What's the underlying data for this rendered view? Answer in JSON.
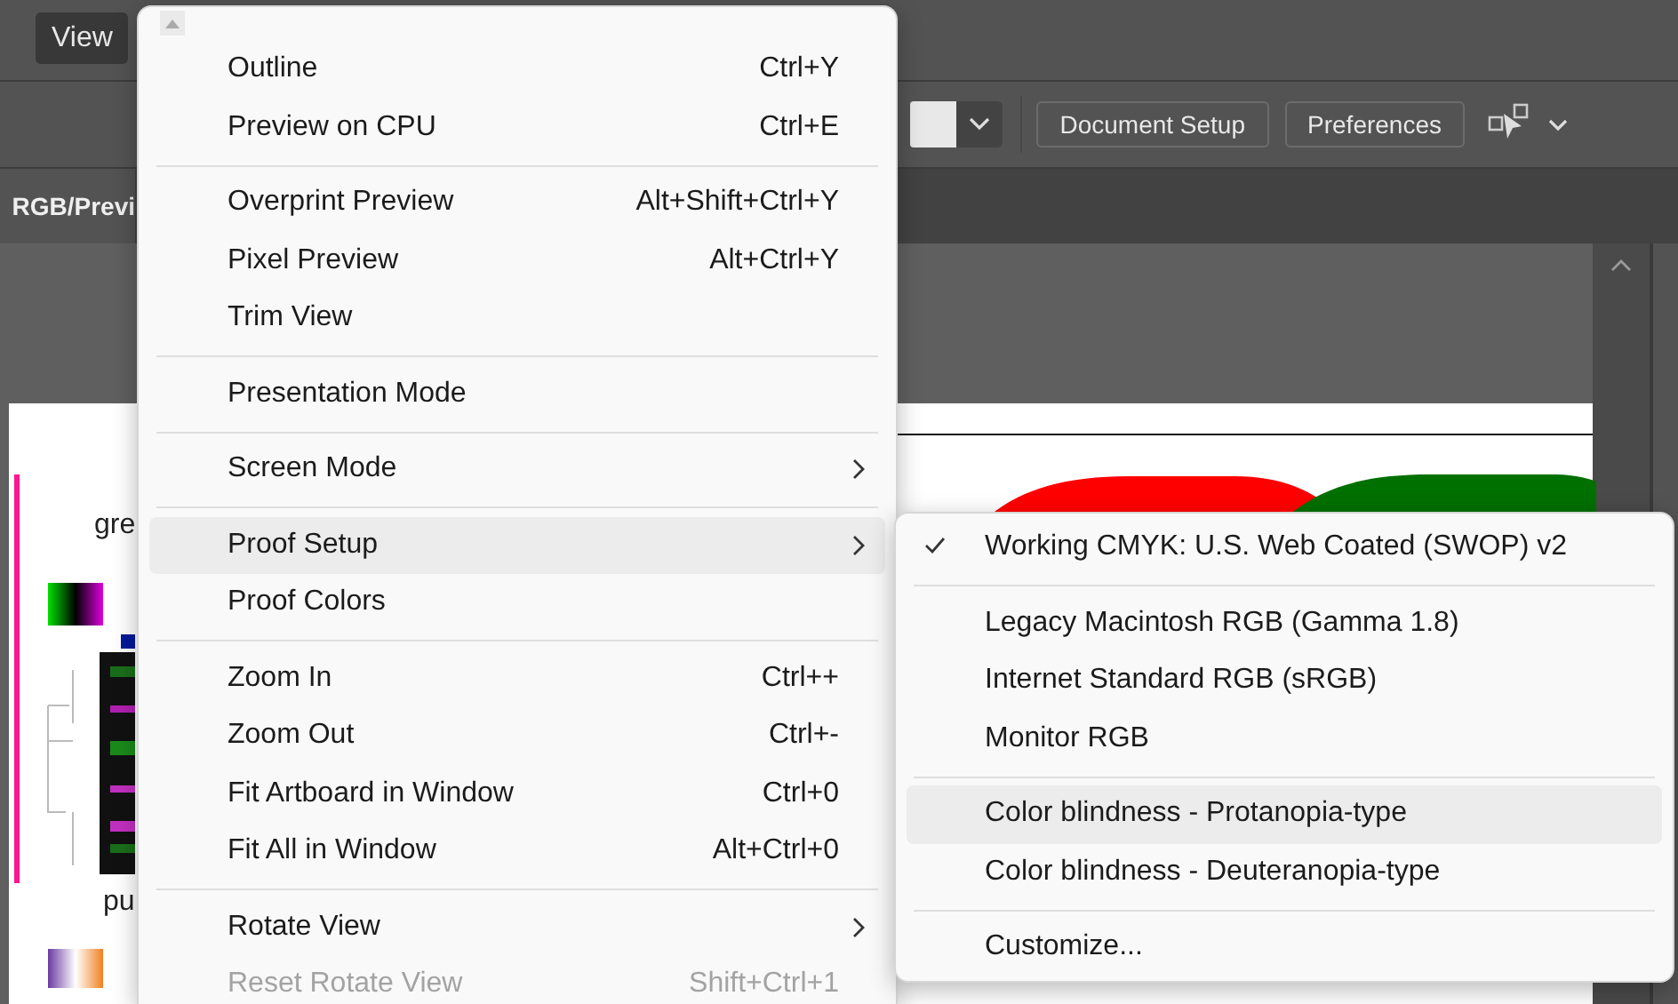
{
  "menubar": [
    {
      "label": "View",
      "selected": true
    }
  ],
  "control_bar": {
    "buttons": [
      "Document Setup",
      "Preferences"
    ]
  },
  "document_tab": {
    "label": "RGB/Previ"
  },
  "artboard": {
    "labels": [
      "gre",
      "pu"
    ]
  },
  "view_menu": {
    "items": [
      {
        "kind": "item",
        "label": "Outline",
        "shortcut": "Ctrl+Y",
        "submenu": false,
        "highlighted": false,
        "disabled": false
      },
      {
        "kind": "item",
        "label": "Preview on CPU",
        "shortcut": "Ctrl+E",
        "submenu": false,
        "highlighted": false,
        "disabled": false
      },
      {
        "kind": "separator"
      },
      {
        "kind": "item",
        "label": "Overprint Preview",
        "shortcut": "Alt+Shift+Ctrl+Y",
        "submenu": false,
        "highlighted": false,
        "disabled": false
      },
      {
        "kind": "item",
        "label": "Pixel Preview",
        "shortcut": "Alt+Ctrl+Y",
        "submenu": false,
        "highlighted": false,
        "disabled": false
      },
      {
        "kind": "item",
        "label": "Trim View",
        "submenu": false,
        "highlighted": false,
        "disabled": false
      },
      {
        "kind": "separator"
      },
      {
        "kind": "item",
        "label": "Presentation Mode",
        "submenu": false,
        "highlighted": false,
        "disabled": false
      },
      {
        "kind": "separator"
      },
      {
        "kind": "item",
        "label": "Screen Mode",
        "submenu": true,
        "highlighted": false,
        "disabled": false
      },
      {
        "kind": "separator"
      },
      {
        "kind": "item",
        "label": "Proof Setup",
        "submenu": true,
        "highlighted": true,
        "disabled": false
      },
      {
        "kind": "item",
        "label": "Proof Colors",
        "submenu": false,
        "highlighted": false,
        "disabled": false
      },
      {
        "kind": "separator"
      },
      {
        "kind": "item",
        "label": "Zoom In",
        "shortcut": "Ctrl++",
        "submenu": false,
        "highlighted": false,
        "disabled": false
      },
      {
        "kind": "item",
        "label": "Zoom Out",
        "shortcut": "Ctrl+-",
        "submenu": false,
        "highlighted": false,
        "disabled": false
      },
      {
        "kind": "item",
        "label": "Fit Artboard in Window",
        "shortcut": "Ctrl+0",
        "submenu": false,
        "highlighted": false,
        "disabled": false
      },
      {
        "kind": "item",
        "label": "Fit All in Window",
        "shortcut": "Alt+Ctrl+0",
        "submenu": false,
        "highlighted": false,
        "disabled": false
      },
      {
        "kind": "separator"
      },
      {
        "kind": "item",
        "label": "Rotate View",
        "submenu": true,
        "highlighted": false,
        "disabled": false
      },
      {
        "kind": "item",
        "label": "Reset Rotate View",
        "shortcut": "Shift+Ctrl+1",
        "submenu": false,
        "highlighted": false,
        "disabled": true
      }
    ]
  },
  "proof_setup_submenu": {
    "items": [
      {
        "kind": "item",
        "label": "Working CMYK: U.S. Web Coated (SWOP) v2",
        "checked": true,
        "highlighted": false
      },
      {
        "kind": "separator"
      },
      {
        "kind": "item",
        "label": "Legacy Macintosh RGB (Gamma 1.8)",
        "checked": false,
        "highlighted": false
      },
      {
        "kind": "item",
        "label": "Internet Standard RGB (sRGB)",
        "checked": false,
        "highlighted": false
      },
      {
        "kind": "item",
        "label": "Monitor RGB",
        "checked": false,
        "highlighted": false
      },
      {
        "kind": "separator"
      },
      {
        "kind": "item",
        "label": "Color blindness - Protanopia-type",
        "checked": false,
        "highlighted": true
      },
      {
        "kind": "item",
        "label": "Color blindness - Deuteranopia-type",
        "checked": false,
        "highlighted": false
      },
      {
        "kind": "separator"
      },
      {
        "kind": "item",
        "label": "Customize...",
        "checked": false,
        "highlighted": false
      }
    ]
  }
}
